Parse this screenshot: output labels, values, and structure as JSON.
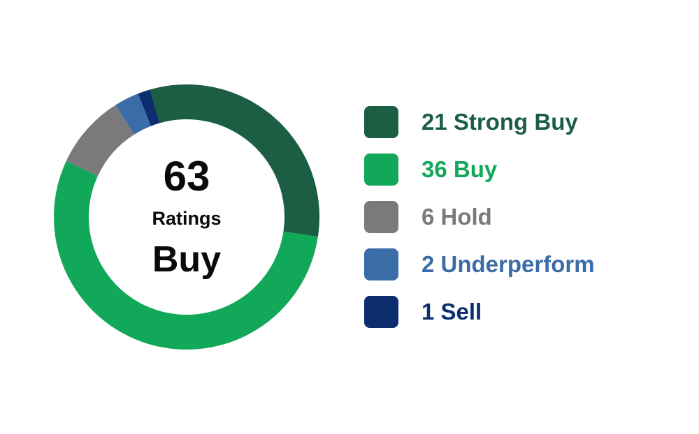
{
  "chart_data": {
    "type": "pie",
    "categories": [
      "Strong Buy",
      "Buy",
      "Hold",
      "Underperform",
      "Sell"
    ],
    "values": [
      21,
      36,
      6,
      2,
      1
    ],
    "colors": [
      "#1b5e44",
      "#12a85a",
      "#7a7a7a",
      "#3a6ca8",
      "#0c2d6e"
    ],
    "legend_labels": [
      "21 Strong Buy",
      "36 Buy",
      "6 Hold",
      "2 Underperform",
      "1 Sell"
    ],
    "center": {
      "total": "63",
      "total_label": "Ratings",
      "consensus": "Buy"
    },
    "legend_position": "right"
  }
}
